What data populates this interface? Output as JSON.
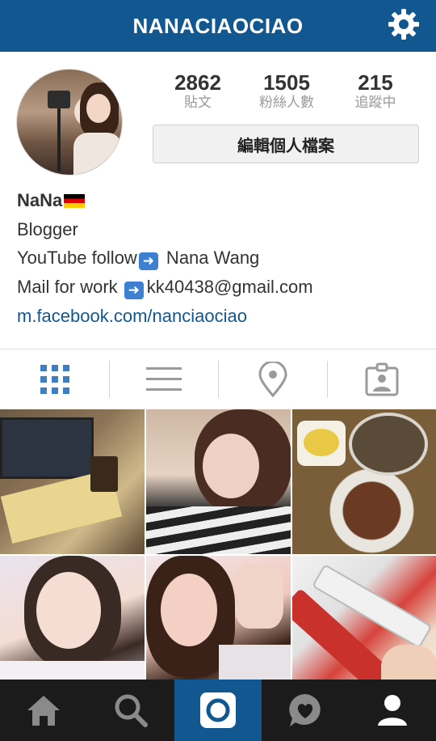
{
  "header": {
    "title": "NANACIAOCIAO",
    "icon": "gear-icon",
    "bg_color": "#12578f"
  },
  "profile": {
    "stats": [
      {
        "value": "2862",
        "label": "貼文"
      },
      {
        "value": "1505",
        "label": "粉絲人數"
      },
      {
        "value": "215",
        "label": "追蹤中"
      }
    ],
    "edit_button_label": "編輯個人檔案",
    "bio": {
      "name": "NaNa",
      "line2": "Blogger",
      "line3_prefix": "YouTube follow",
      "line3_suffix": " Nana Wang",
      "line4_prefix": "Mail for work ",
      "line4_suffix": "kk40438@gmail.com",
      "link": "m.facebook.com/nanciaociao"
    }
  },
  "tabs": [
    {
      "name": "grid-view",
      "icon": "grid-icon",
      "active": true
    },
    {
      "name": "list-view",
      "icon": "list-icon",
      "active": false
    },
    {
      "name": "map-view",
      "icon": "location-pin-icon",
      "active": false
    },
    {
      "name": "tagged-view",
      "icon": "person-tag-icon",
      "active": false
    }
  ],
  "posts": [
    "photo-laptop-study",
    "photo-selfie-striped-shirt",
    "photo-noodle-soup",
    "photo-selfie-smile",
    "photo-selfie-peace",
    "photo-mickey-pens"
  ],
  "bottom_nav": [
    {
      "name": "home",
      "icon": "home-icon",
      "active": false
    },
    {
      "name": "search",
      "icon": "search-icon",
      "active": false
    },
    {
      "name": "camera",
      "icon": "camera-icon",
      "active": true
    },
    {
      "name": "activity",
      "icon": "heart-bubble-icon",
      "active": false
    },
    {
      "name": "profile",
      "icon": "profile-icon",
      "active": false
    }
  ]
}
